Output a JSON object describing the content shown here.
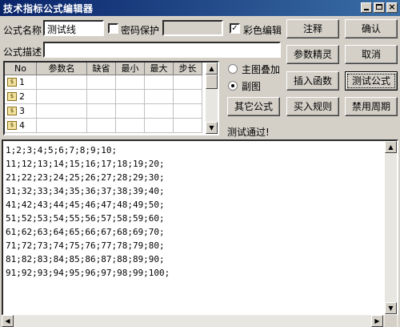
{
  "window": {
    "title": "技术指标公式编辑器"
  },
  "form": {
    "name_label": "公式名称",
    "name_value": "测试线",
    "password_label": "密码保护",
    "password_checked": false,
    "color_edit_label": "彩色编辑",
    "color_edit_checked": true,
    "desc_label": "公式描述",
    "desc_value": ""
  },
  "param_table": {
    "columns": [
      "No",
      "参数名",
      "缺省",
      "最小",
      "最大",
      "步长"
    ],
    "rows": [
      "1",
      "2",
      "3",
      "4"
    ],
    "row_icon": "formula-param-icon"
  },
  "options": {
    "main_overlay_label": "主图叠加",
    "sub_chart_label": "副图",
    "selected": "副图"
  },
  "buttons": {
    "comment": "注释",
    "confirm": "确认",
    "param_wizard": "参数精灵",
    "cancel": "取消",
    "insert_func": "插入函数",
    "test_formula": "测试公式",
    "other_formula": "其它公式",
    "buy_rule": "买入规则",
    "disable_period": "禁用周期"
  },
  "status": {
    "message": "测试通过!"
  },
  "editor": {
    "lines": [
      "1;2;3;4;5;6;7;8;9;10;",
      "11;12;13;14;15;16;17;18;19;20;",
      "21;22;23;24;25;26;27;28;29;30;",
      "31;32;33;34;35;36;37;38;39;40;",
      "41;42;43;44;45;46;47;48;49;50;",
      "51;52;53;54;55;56;57;58;59;60;",
      "61;62;63;64;65;66;67;68;69;70;",
      "71;72;73;74;75;76;77;78;79;80;",
      "81;82;83;84;85;86;87;88;89;90;",
      "91;92;93;94;95;96;97;98;99;100;"
    ]
  },
  "icons": {
    "minimize": "minimize-icon",
    "maximize": "maximize-icon",
    "close": "close-icon",
    "scroll_up": "arrow-up-icon",
    "scroll_down": "arrow-down-icon",
    "scroll_left": "arrow-left-icon",
    "scroll_right": "arrow-right-icon"
  },
  "colors": {
    "titlebar_start": "#0a246a",
    "titlebar_end": "#3a6ea5",
    "window_bg": "#d4d0c8"
  }
}
